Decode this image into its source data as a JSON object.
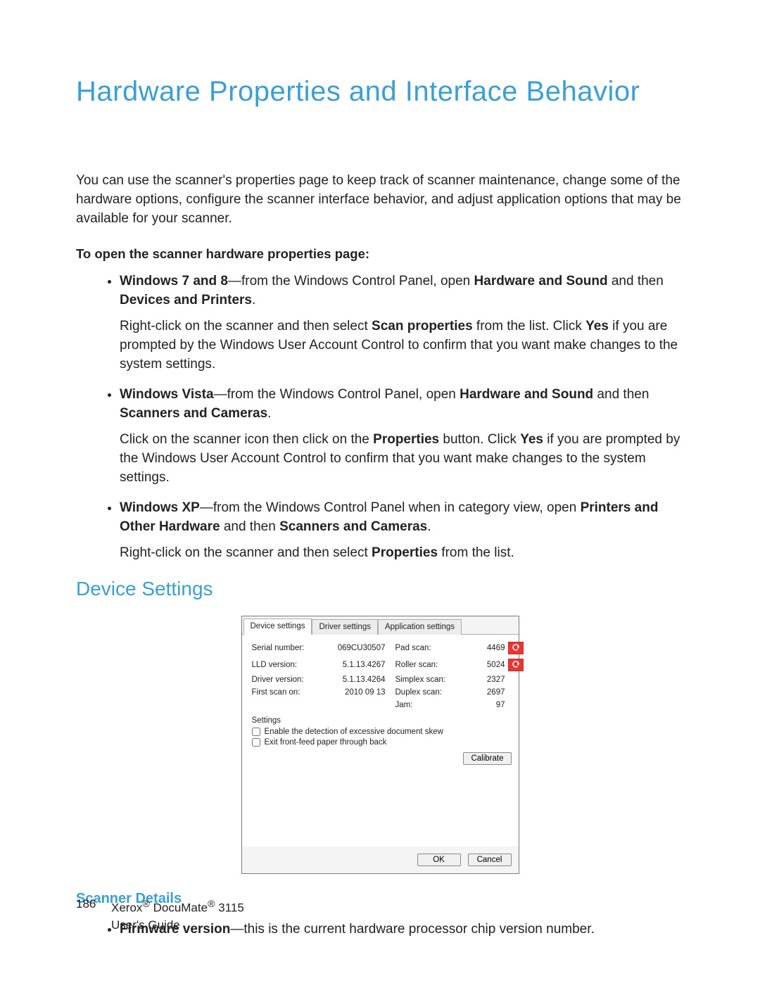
{
  "title": "Hardware Properties and Interface Behavior",
  "intro": "You can use the scanner's properties page to keep track of scanner maintenance, change some of the hardware options, configure the scanner interface behavior, and adjust application options that may be available for your scanner.",
  "open_heading": "To open the scanner hardware properties page:",
  "bullets": {
    "win78_lead_bold": "Windows 7 and 8",
    "win78_lead_rest": "—from the Windows Control Panel, open ",
    "win78_hw_bold": "Hardware and Sound",
    "win78_then": " and then ",
    "win78_dev_bold": "Devices and Printers",
    "win78_para_a": "Right-click on the scanner and then select ",
    "win78_scanprop_bold": "Scan properties",
    "win78_para_b": " from the list. Click ",
    "win78_yes_bold": "Yes",
    "win78_para_c": " if you are prompted by the Windows User Account Control to confirm that you want make changes to the system settings.",
    "vista_lead_bold": "Windows Vista",
    "vista_lead_rest": "—from the Windows Control Panel, open ",
    "vista_hw_bold": "Hardware and Sound",
    "vista_then": " and then ",
    "vista_sc_bold": "Scanners and Cameras",
    "vista_para_a": "Click on the scanner icon then click on the ",
    "vista_prop_bold": "Properties",
    "vista_para_b": " button. Click ",
    "vista_yes_bold": "Yes",
    "vista_para_c": " if you are prompted by the Windows User Account Control to confirm that you want make changes to the system settings.",
    "xp_lead_bold": "Windows XP",
    "xp_lead_rest": "—from the Windows Control Panel when in category view, open ",
    "xp_po_bold": "Printers and Other Hardware",
    "xp_then": " and then ",
    "xp_sc_bold": "Scanners and Cameras",
    "xp_para_a": "Right-click on the scanner and then select ",
    "xp_prop_bold": "Properties",
    "xp_para_b": " from the list."
  },
  "device_settings_heading": "Device Settings",
  "dialog": {
    "tabs": {
      "t1": "Device settings",
      "t2": "Driver settings",
      "t3": "Application settings"
    },
    "left": {
      "serial_label": "Serial number:",
      "serial_value": "069CU30507",
      "lld_label": "LLD version:",
      "lld_value": "5.1.13.4267",
      "driver_label": "Driver version:",
      "driver_value": "5.1.13.4264",
      "first_label": "First scan on:",
      "first_value": "2010 09 13"
    },
    "right": {
      "pad_label": "Pad scan:",
      "pad_value": "4469",
      "roller_label": "Roller scan:",
      "roller_value": "5024",
      "simplex_label": "Simplex scan:",
      "simplex_value": "2327",
      "duplex_label": "Duplex scan:",
      "duplex_value": "2697",
      "jam_label": "Jam:",
      "jam_value": "97"
    },
    "settings_label": "Settings",
    "chk_skew": "Enable the detection of excessive document skew",
    "chk_exit": "Exit front-feed paper through back",
    "calibrate": "Calibrate",
    "ok": "OK",
    "cancel": "Cancel"
  },
  "scanner_details_heading": "Scanner Details",
  "firmware_lead_bold": "Firmware version",
  "firmware_rest": "—this is the current hardware processor chip version number.",
  "footer": {
    "page_no": "186",
    "line1_a": "Xerox",
    "line1_b": " DocuMate",
    "line1_c": " 3115",
    "line2": "User's Guide",
    "reg": "®"
  }
}
